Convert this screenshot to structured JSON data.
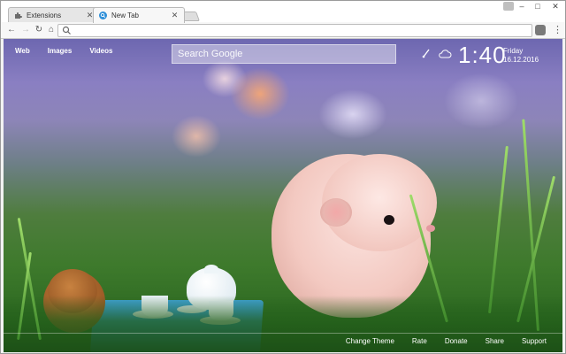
{
  "tabs": [
    {
      "title": "Extensions",
      "icon": "puzzle-icon",
      "active": false
    },
    {
      "title": "New Tab",
      "icon": "search-icon",
      "active": true
    }
  ],
  "toolbar": {
    "omnibox_value": "",
    "omnibox_placeholder": ""
  },
  "ntp": {
    "top_links": [
      "Web",
      "Images",
      "Videos"
    ],
    "search_placeholder": "Search Google",
    "clock": "1:40",
    "day": "Friday",
    "date": "16.12.2016",
    "footer_links": [
      "Change Theme",
      "Rate",
      "Donate",
      "Share",
      "Support"
    ]
  },
  "colors": {
    "tab_active_bg": "#f7f7f7",
    "omnibox_border": "#bdbdbd",
    "overlay_text": "#ffffff"
  }
}
